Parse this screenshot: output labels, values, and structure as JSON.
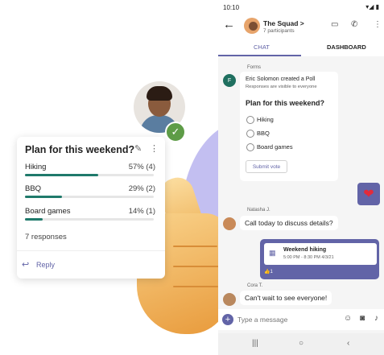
{
  "colors": {
    "accent": "#6264a7",
    "teal": "#1f7a6b",
    "check_green": "#5e9c47",
    "heart_red": "#e22b3b"
  },
  "poll_card": {
    "title": "Plan for this weekend?",
    "edit_icon": "✎",
    "more_icon": "⋮",
    "options": [
      {
        "label": "Hiking",
        "value": "57% (4)",
        "fraction": 0.57
      },
      {
        "label": "BBQ",
        "value": "29% (2)",
        "fraction": 0.29
      },
      {
        "label": "Board games",
        "value": "14% (1)",
        "fraction": 0.14
      }
    ],
    "responses": "7 responses",
    "reply_icon": "↩",
    "reply_label": "Reply"
  },
  "profile_badge": {
    "check_icon": "✓"
  },
  "phone": {
    "status": {
      "time": "10:10",
      "icons": "▾◢ ▮"
    },
    "header": {
      "back_icon": "←",
      "group_name": "The Squad >",
      "participants": "7 participants",
      "video_icon": "▭",
      "call_icon": "✆",
      "more_icon": "⋮"
    },
    "tabs": [
      {
        "label": "CHAT"
      },
      {
        "label": "DASHBOARD"
      }
    ],
    "forms_message": {
      "sender": "Forms",
      "avatar_text": "F",
      "title": "Eric Solomon created a Poll",
      "subtitle": "Responses are visible to everyone",
      "question": "Plan for this weekend?",
      "options": [
        "Hiking",
        "BBQ",
        "Board games"
      ],
      "submit_label": "Submit vote"
    },
    "heart_icon": "❤",
    "messages": [
      {
        "sender": "Natasha J.",
        "text": "Call today to discuss details?"
      },
      {
        "sender": "Cora T.",
        "text": "Can't wait to see everyone!"
      }
    ],
    "event": {
      "calendar_icon": "▦",
      "title": "Weekend hiking",
      "time": "5:00 PM - 8:30 PM 4/3/21",
      "reaction": "👍1"
    },
    "composer": {
      "plus_icon": "+",
      "placeholder": "Type a message",
      "emoji_icon": "☺",
      "camera_icon": "◙",
      "mic_icon": "♪"
    },
    "navbar": {
      "recent_icon": "|||",
      "home_icon": "○",
      "back_icon": "‹"
    }
  }
}
